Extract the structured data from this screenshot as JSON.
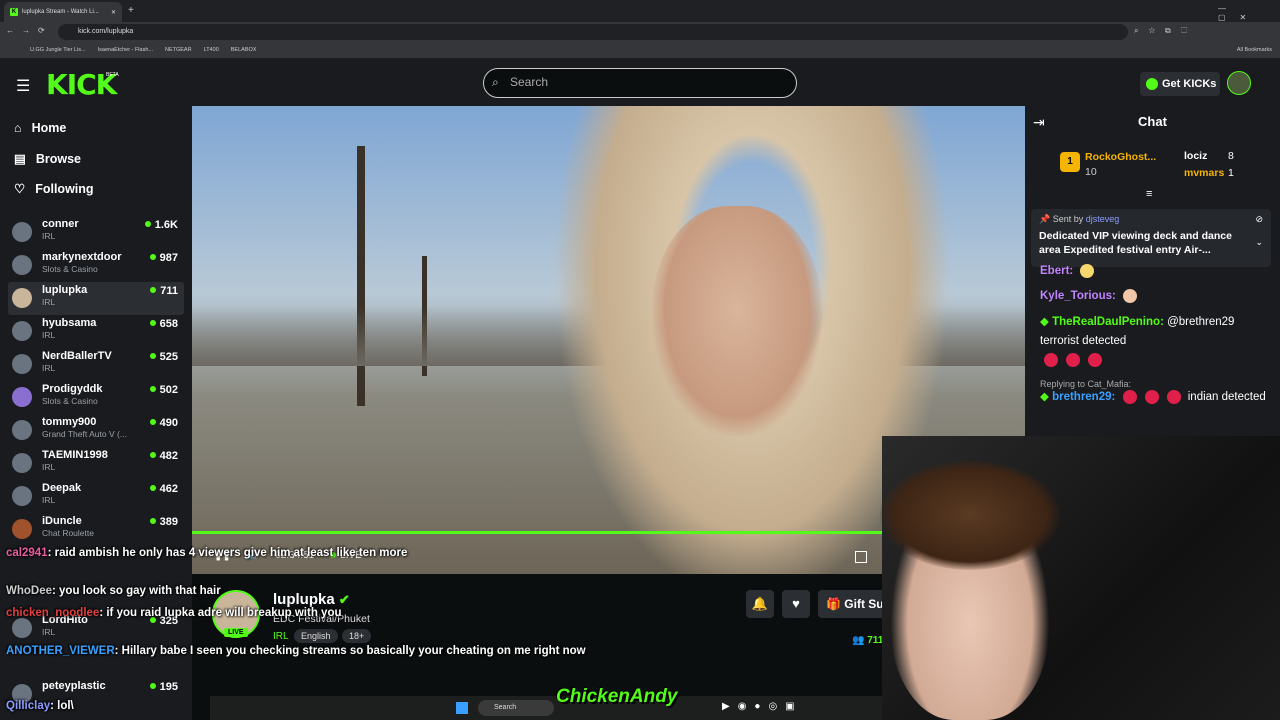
{
  "browser": {
    "tab_title": "luplupka Stream - Watch Li...",
    "url": "kick.com/luplupka",
    "bookmarks": [
      "U.GG Jungle Tier Lis...",
      "IsaenaEtcher - Flash...",
      "NETGEAR",
      "LT400",
      "BELABOX"
    ],
    "all_bookmarks": "All Bookmarks"
  },
  "header": {
    "logo": "KICK",
    "beta": "BETA",
    "search_placeholder": "Search",
    "get_kicks": "Get KICKs"
  },
  "sidebar": {
    "nav": [
      {
        "label": "Home",
        "icon": "home-icon"
      },
      {
        "label": "Browse",
        "icon": "browse-icon"
      },
      {
        "label": "Following",
        "icon": "heart-icon"
      }
    ],
    "channels": [
      {
        "name": "conner",
        "category": "IRL",
        "viewers": "1.6K"
      },
      {
        "name": "markynextdoor",
        "category": "Slots & Casino",
        "viewers": "987"
      },
      {
        "name": "luplupka",
        "category": "IRL",
        "viewers": "711"
      },
      {
        "name": "hyubsama",
        "category": "IRL",
        "viewers": "658"
      },
      {
        "name": "NerdBallerTV",
        "category": "IRL",
        "viewers": "525"
      },
      {
        "name": "Prodigyddk",
        "category": "Slots & Casino",
        "viewers": "502"
      },
      {
        "name": "tommy900",
        "category": "Grand Theft Auto V (...",
        "viewers": "490"
      },
      {
        "name": "TAEMIN1998",
        "category": "IRL",
        "viewers": "482"
      },
      {
        "name": "Deepak",
        "category": "IRL",
        "viewers": "462"
      },
      {
        "name": "iDuncle",
        "category": "Chat Roulette",
        "viewers": "389"
      },
      {
        "name": "LordHito",
        "category": "IRL",
        "viewers": "325"
      },
      {
        "name": "peteyplastic",
        "category": "",
        "viewers": "195"
      }
    ]
  },
  "player": {
    "time": "02:34:51",
    "live": "LIVE"
  },
  "stream": {
    "name": "luplupka",
    "title": "EDC Festival/Phuket",
    "category": "IRL",
    "tags": [
      "English",
      "18+"
    ],
    "live_badge": "LIVE",
    "gift_label": "Gift Su",
    "viewers": "711"
  },
  "chat": {
    "header": "Chat",
    "leaderboard": [
      {
        "rank": "1",
        "name": "RockoGhost...",
        "count": "10"
      },
      {
        "name": "lociz",
        "count": "8"
      },
      {
        "name": "mvmars",
        "count": "1"
      }
    ],
    "pinned": {
      "sent_by_label": "Sent by",
      "sent_by": "djsteveg",
      "text": "Dedicated VIP viewing deck and dance area Expedited festival entry Air-..."
    },
    "messages": [
      {
        "user": "Ebert",
        "text": ""
      },
      {
        "user": "Kyle_Torious",
        "text": ""
      },
      {
        "user": "TheRealDaulPenino",
        "text": "@brethren29 terrorist detected"
      },
      {
        "reply": "Replying to Cat_Mafia:",
        "user": "brethren29",
        "text": "indian detected"
      }
    ]
  },
  "overlay_chat": [
    {
      "user": "cal2941",
      "text": "raid ambish he only has 4 viewers give him at least like ten more"
    },
    {
      "user": "WhoDee",
      "text": "you look so gay with that hair"
    },
    {
      "user": "chicken_noodlee",
      "text": "if you raid lupka adre will breakup with you"
    },
    {
      "user": "ANOTHER_VIEWER",
      "text": "Hillary babe I seen you checking streams so basically your cheating on me right now"
    },
    {
      "user": "Qilliclay",
      "text": "lol\\"
    }
  ],
  "taskbar": {
    "search": "Search"
  },
  "watermark": "ChickenAndy",
  "colors": {
    "accent": "#53fc18",
    "background": "#0b0e0f",
    "panel": "#191b1f"
  }
}
